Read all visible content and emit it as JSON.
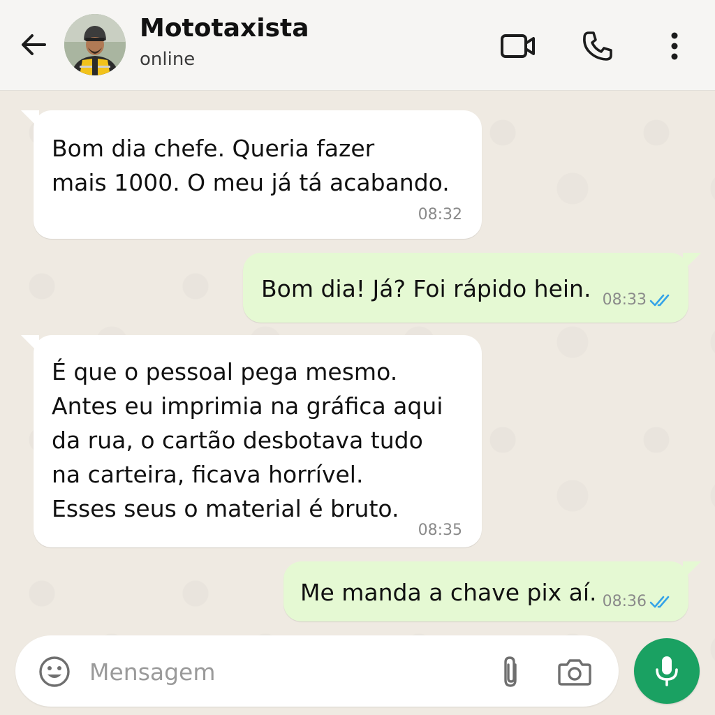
{
  "header": {
    "contact_name": "Mototaxista",
    "status": "online",
    "icons": {
      "back": "arrow-left-icon",
      "video": "video-camera-icon",
      "call": "phone-icon",
      "menu": "more-vertical-icon"
    }
  },
  "messages": [
    {
      "direction": "incoming",
      "text": "Bom dia chefe. Queria fazer\nmais 1000. O meu já tá acabando.",
      "time": "08:32"
    },
    {
      "direction": "outgoing",
      "text": "Bom dia! Já? Foi rápido hein.",
      "time": "08:33",
      "status": "read"
    },
    {
      "direction": "incoming",
      "text": "É que o pessoal pega mesmo.\nAntes eu imprimia na gráfica aqui\nda rua, o cartão desbotava tudo\nna carteira, ficava horrível.\nEsses seus o material é bruto.",
      "time": "08:35"
    },
    {
      "direction": "outgoing",
      "text": "Me manda a chave pix aí.",
      "time": "08:36",
      "status": "read"
    }
  ],
  "composer": {
    "placeholder": "Mensagem",
    "value": "",
    "icons": {
      "emoji": "emoji-icon",
      "attach": "paperclip-icon",
      "camera": "camera-icon",
      "mic": "microphone-icon"
    }
  },
  "colors": {
    "accent": "#1aa162",
    "outgoing_bubble": "#e5f9d3",
    "incoming_bubble": "#ffffff",
    "chat_background": "#efeae2",
    "read_ticks": "#34a3e8"
  }
}
